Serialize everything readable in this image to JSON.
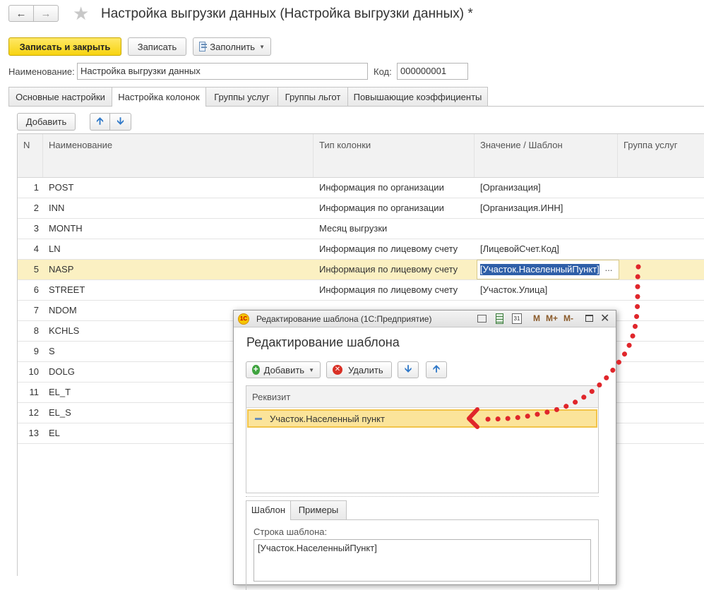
{
  "window": {
    "title": "Настройка выгрузки данных (Настройка выгрузки данных) *"
  },
  "toolbar": {
    "save_close": "Записать и закрыть",
    "save": "Записать",
    "fill": "Заполнить"
  },
  "form": {
    "name_label": "Наименование:",
    "name_value": "Настройка выгрузки данных",
    "code_label": "Код:",
    "code_value": "000000001"
  },
  "tabs": [
    {
      "label": "Основные настройки"
    },
    {
      "label": "Настройка колонок"
    },
    {
      "label": "Группы услуг"
    },
    {
      "label": "Группы льгот"
    },
    {
      "label": "Повышающие коэффициенты"
    }
  ],
  "grid": {
    "add_label": "Добавить",
    "headers": {
      "n": "N",
      "name": "Наименование",
      "type": "Тип колонки",
      "value": "Значение / Шаблон",
      "group": "Группа услуг"
    },
    "rows": [
      {
        "n": "1",
        "name": "POST",
        "type": "Информация по организации",
        "value": "[Организация]"
      },
      {
        "n": "2",
        "name": "INN",
        "type": "Информация по организации",
        "value": "[Организация.ИНН]"
      },
      {
        "n": "3",
        "name": "MONTH",
        "type": "Месяц выгрузки",
        "value": ""
      },
      {
        "n": "4",
        "name": "LN",
        "type": "Информация по лицевому счету",
        "value": "[ЛицевойСчет.Код]"
      },
      {
        "n": "5",
        "name": "NASP",
        "type": "Информация по лицевому счету",
        "value": "[Участок.НаселенныйПункт]"
      },
      {
        "n": "6",
        "name": "STREET",
        "type": "Информация по лицевому счету",
        "value": "[Участок.Улица]"
      },
      {
        "n": "7",
        "name": "NDOM",
        "type": "",
        "value": ""
      },
      {
        "n": "8",
        "name": "KCHLS",
        "type": "",
        "value": ""
      },
      {
        "n": "9",
        "name": "S",
        "type": "",
        "value": ""
      },
      {
        "n": "10",
        "name": "DOLG",
        "type": "",
        "value": ""
      },
      {
        "n": "11",
        "name": "EL_T",
        "type": "",
        "value": ""
      },
      {
        "n": "12",
        "name": "EL_S",
        "type": "",
        "value": ""
      },
      {
        "n": "13",
        "name": "EL",
        "type": "",
        "value": ""
      }
    ],
    "ellipsis": "..."
  },
  "dialog": {
    "title_bar": "Редактирование шаблона  (1С:Предприятие)",
    "heading": "Редактирование шаблона",
    "add_label": "Добавить",
    "delete_label": "Удалить",
    "list_header": "Реквизит",
    "list_item": "Участок.Населенный пункт",
    "tab_template": "Шаблон",
    "tab_examples": "Примеры",
    "template_label": "Строка шаблона:",
    "template_value": "[Участок.НаселенныйПункт]",
    "title_buttons": [
      "M",
      "M+",
      "M-"
    ],
    "calendar_glyph": "31"
  },
  "colors": {
    "primary_button": "#f7d310",
    "selection_row": "#fbf0c2",
    "annotation_red": "#e0262b",
    "arrow_blue": "#2f78c8"
  }
}
